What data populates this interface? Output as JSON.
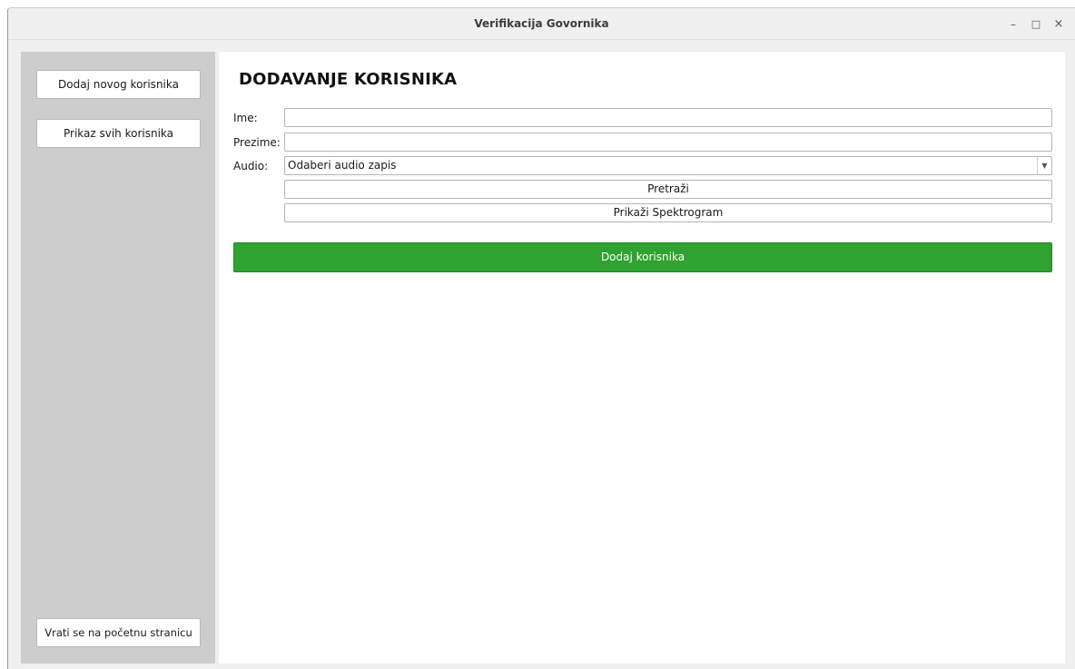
{
  "window": {
    "title": "Verifikacija Govornika",
    "controls": {
      "minimize": "–",
      "maximize": "□",
      "close": "×"
    }
  },
  "sidebar": {
    "items": [
      {
        "label": "Dodaj novog korisnika"
      },
      {
        "label": "Prikaz svih korisnika"
      }
    ],
    "back_label": "Vrati se na početnu stranicu"
  },
  "form": {
    "title": "DODAVANJE KORISNIKA",
    "ime_label": "Ime:",
    "ime_value": "",
    "prezime_label": "Prezime:",
    "prezime_value": "",
    "audio_label": "Audio:",
    "audio_selected": "Odaberi audio zapis",
    "search_label": "Pretraži",
    "spectrogram_label": "Prikaži Spektrogram",
    "submit_label": "Dodaj korisnika"
  },
  "colors": {
    "accent_green": "#2fa22f",
    "sidebar_bg": "#cdcdcd"
  }
}
